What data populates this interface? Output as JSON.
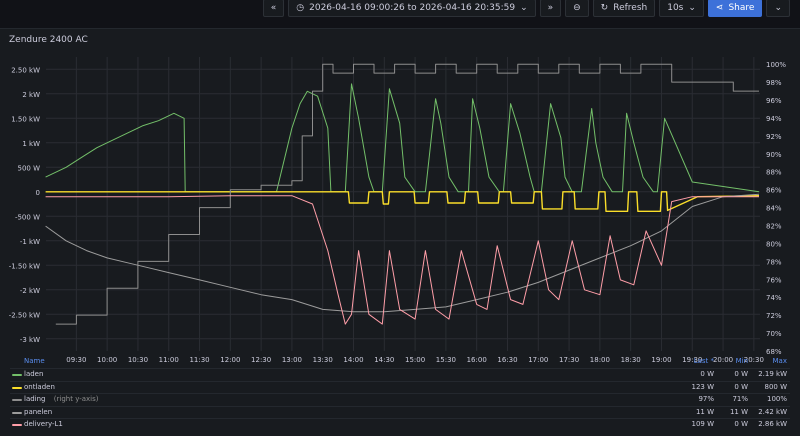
{
  "toolbar": {
    "time_range": "2026-04-16 09:00:26 to 2026-04-16 20:35:59",
    "refresh_label": "Refresh",
    "interval": "10s",
    "share_label": "Share"
  },
  "panel": {
    "title": "Zendure 2400 AC"
  },
  "legend": {
    "headers": {
      "name": "Name",
      "last": "Last *",
      "min": "Min",
      "max": "Max"
    },
    "rows": [
      {
        "name": "laden",
        "sub": "",
        "color": "#73bf69",
        "last": "0 W",
        "min": "0 W",
        "max": "2.19 kW"
      },
      {
        "name": "ontladen",
        "sub": "",
        "color": "#fade2a",
        "last": "123 W",
        "min": "0 W",
        "max": "800 W"
      },
      {
        "name": "lading",
        "sub": "(right y-axis)",
        "color": "#8e8e8e",
        "last": "97%",
        "min": "71%",
        "max": "100%"
      },
      {
        "name": "panelen",
        "sub": "",
        "color": "#9c9c9c",
        "last": "11 W",
        "min": "11 W",
        "max": "2.42 kW"
      },
      {
        "name": "delivery-L1",
        "sub": "",
        "color": "#ff9ea8",
        "last": "109 W",
        "min": "0 W",
        "max": "2.86 kW"
      }
    ]
  },
  "chart_data": {
    "type": "line",
    "title": "Zendure 2400 AC",
    "x_range": [
      "09:00:26",
      "20:35:59"
    ],
    "x_ticks": [
      "09:30",
      "10:00",
      "10:30",
      "11:00",
      "11:30",
      "12:00",
      "12:30",
      "13:00",
      "13:30",
      "14:00",
      "14:30",
      "15:00",
      "15:30",
      "16:00",
      "16:30",
      "17:00",
      "17:30",
      "18:00",
      "18:30",
      "19:00",
      "19:30",
      "20:00",
      "20:30"
    ],
    "y_left": {
      "unit": "W",
      "ylim": [
        -3250,
        2750
      ],
      "ticks": [
        2500,
        2000,
        1500,
        1000,
        500,
        0,
        -500,
        -1000,
        -1500,
        -2000,
        -2500,
        -3000
      ],
      "tick_labels": [
        "2.50 kW",
        "2 kW",
        "1.50 kW",
        "1 kW",
        "500 W",
        "0",
        "-500 W",
        "-1 kW",
        "-1.50 kW",
        "-2 kW",
        "-2.50 kW",
        "-3 kW"
      ]
    },
    "y_right": {
      "unit": "%",
      "ylim": [
        68,
        100.8
      ],
      "ticks": [
        100,
        98,
        96,
        94,
        92,
        90,
        88,
        86,
        84,
        82,
        80,
        78,
        76,
        74,
        72,
        70,
        68
      ],
      "tick_labels": [
        "100%",
        "98%",
        "96%",
        "94%",
        "92%",
        "90%",
        "88%",
        "86%",
        "84%",
        "82%",
        "80%",
        "78%",
        "76%",
        "74%",
        "72%",
        "70%",
        "68%"
      ]
    },
    "grid": true,
    "legend_position": "bottom",
    "series": [
      {
        "name": "laden",
        "color": "#73bf69",
        "axis": "left",
        "x": [
          "09:00",
          "09:20",
          "09:35",
          "09:50",
          "10:05",
          "10:20",
          "10:35",
          "10:50",
          "11:05",
          "11:15",
          "11:16",
          "12:00",
          "12:45",
          "13:00",
          "13:08",
          "13:15",
          "13:25",
          "13:35",
          "13:38",
          "13:45",
          "13:52",
          "13:58",
          "14:05",
          "14:15",
          "14:20",
          "14:28",
          "14:35",
          "14:45",
          "14:50",
          "15:00",
          "15:10",
          "15:20",
          "15:25",
          "15:33",
          "15:42",
          "15:52",
          "15:56",
          "16:03",
          "16:12",
          "16:22",
          "16:26",
          "16:33",
          "16:42",
          "16:52",
          "16:56",
          "17:03",
          "17:12",
          "17:22",
          "17:26",
          "17:33",
          "17:42",
          "17:52",
          "17:56",
          "18:03",
          "18:12",
          "18:22",
          "18:26",
          "18:33",
          "18:42",
          "18:52",
          "18:56",
          "19:03",
          "19:30",
          "20:35"
        ],
        "y": [
          300,
          500,
          700,
          900,
          1050,
          1200,
          1350,
          1450,
          1600,
          1500,
          0,
          0,
          0,
          1300,
          1800,
          2050,
          1950,
          1300,
          0,
          0,
          0,
          2200,
          1500,
          300,
          0,
          0,
          2100,
          1400,
          300,
          0,
          0,
          1900,
          1400,
          300,
          0,
          0,
          1900,
          1300,
          300,
          0,
          0,
          1800,
          1200,
          300,
          0,
          0,
          1800,
          1100,
          300,
          0,
          0,
          1700,
          1000,
          300,
          0,
          0,
          1600,
          1000,
          300,
          0,
          0,
          1500,
          200,
          0
        ]
      },
      {
        "name": "ontladen",
        "color": "#fade2a",
        "axis": "left",
        "x": [
          "09:00",
          "13:55",
          "13:56",
          "14:14",
          "14:15",
          "14:28",
          "14:29",
          "14:34",
          "14:35",
          "14:59",
          "15:00",
          "15:13",
          "15:14",
          "15:31",
          "15:32",
          "15:48",
          "15:49",
          "16:01",
          "16:02",
          "16:21",
          "16:22",
          "16:33",
          "16:34",
          "16:55",
          "16:56",
          "17:03",
          "17:04",
          "17:23",
          "17:24",
          "17:35",
          "17:36",
          "17:58",
          "17:59",
          "18:05",
          "18:06",
          "18:27",
          "18:28",
          "18:36",
          "18:37",
          "18:59",
          "19:00",
          "19:05",
          "19:06",
          "19:35",
          "20:35"
        ],
        "y": [
          0,
          0,
          -230,
          -230,
          0,
          0,
          -250,
          -250,
          0,
          0,
          -230,
          -230,
          0,
          0,
          -230,
          -230,
          0,
          0,
          -230,
          -230,
          0,
          0,
          -230,
          -230,
          0,
          0,
          -350,
          -350,
          0,
          0,
          -350,
          -350,
          0,
          0,
          -400,
          -400,
          0,
          0,
          -400,
          -400,
          0,
          0,
          -380,
          -100,
          -80
        ]
      },
      {
        "name": "lading",
        "color": "#8e8e8e",
        "axis": "right",
        "x": [
          "09:10",
          "09:30",
          "10:00",
          "10:30",
          "11:00",
          "11:30",
          "12:00",
          "12:30",
          "13:00",
          "13:10",
          "13:20",
          "13:30",
          "13:40",
          "14:00",
          "14:20",
          "14:40",
          "15:00",
          "15:20",
          "15:40",
          "16:00",
          "16:20",
          "16:40",
          "17:00",
          "17:20",
          "17:40",
          "18:00",
          "18:20",
          "18:40",
          "19:00",
          "19:10",
          "20:10",
          "20:35"
        ],
        "y": [
          71,
          72,
          75,
          78,
          81,
          84,
          86,
          86.5,
          87,
          92,
          97,
          100,
          99,
          100,
          99,
          100,
          99,
          100,
          99,
          100,
          99,
          100,
          99,
          100,
          99,
          100,
          99,
          100,
          100,
          98,
          97,
          97
        ]
      },
      {
        "name": "panelen",
        "color": "#9c9c9c",
        "axis": "left",
        "x": [
          "09:00",
          "09:20",
          "09:40",
          "10:00",
          "10:20",
          "10:40",
          "11:00",
          "11:30",
          "12:00",
          "12:30",
          "13:00",
          "13:30",
          "14:00",
          "14:30",
          "15:00",
          "15:30",
          "16:00",
          "16:30",
          "17:00",
          "17:30",
          "18:00",
          "18:30",
          "19:00",
          "19:30",
          "20:00",
          "20:35"
        ],
        "y": [
          -700,
          -1000,
          -1200,
          -1350,
          -1450,
          -1550,
          -1650,
          -1800,
          -1950,
          -2100,
          -2200,
          -2400,
          -2450,
          -2450,
          -2400,
          -2350,
          -2200,
          -2050,
          -1850,
          -1600,
          -1350,
          -1100,
          -800,
          -300,
          -100,
          -50
        ]
      },
      {
        "name": "delivery-L1",
        "color": "#ff9ea8",
        "axis": "left",
        "x": [
          "09:00",
          "09:30",
          "10:00",
          "10:30",
          "11:00",
          "11:30",
          "12:00",
          "12:30",
          "13:00",
          "13:20",
          "13:35",
          "13:45",
          "13:52",
          "13:58",
          "14:05",
          "14:15",
          "14:28",
          "14:35",
          "14:45",
          "15:00",
          "15:10",
          "15:20",
          "15:33",
          "15:45",
          "16:00",
          "16:10",
          "16:20",
          "16:33",
          "16:45",
          "17:00",
          "17:10",
          "17:20",
          "17:33",
          "17:45",
          "18:00",
          "18:10",
          "18:20",
          "18:33",
          "18:45",
          "19:00",
          "19:10",
          "19:30",
          "20:35"
        ],
        "y": [
          -100,
          -100,
          -100,
          -100,
          -100,
          -90,
          -80,
          -80,
          -80,
          -250,
          -1200,
          -2100,
          -2700,
          -2500,
          -1200,
          -2500,
          -2700,
          -1200,
          -2400,
          -2600,
          -1200,
          -2400,
          -2600,
          -1200,
          -2300,
          -2400,
          -1100,
          -2200,
          -2300,
          -1000,
          -2000,
          -2200,
          -1000,
          -2000,
          -2100,
          -900,
          -1800,
          -1900,
          -800,
          -1500,
          -200,
          -100,
          -100
        ]
      }
    ]
  }
}
